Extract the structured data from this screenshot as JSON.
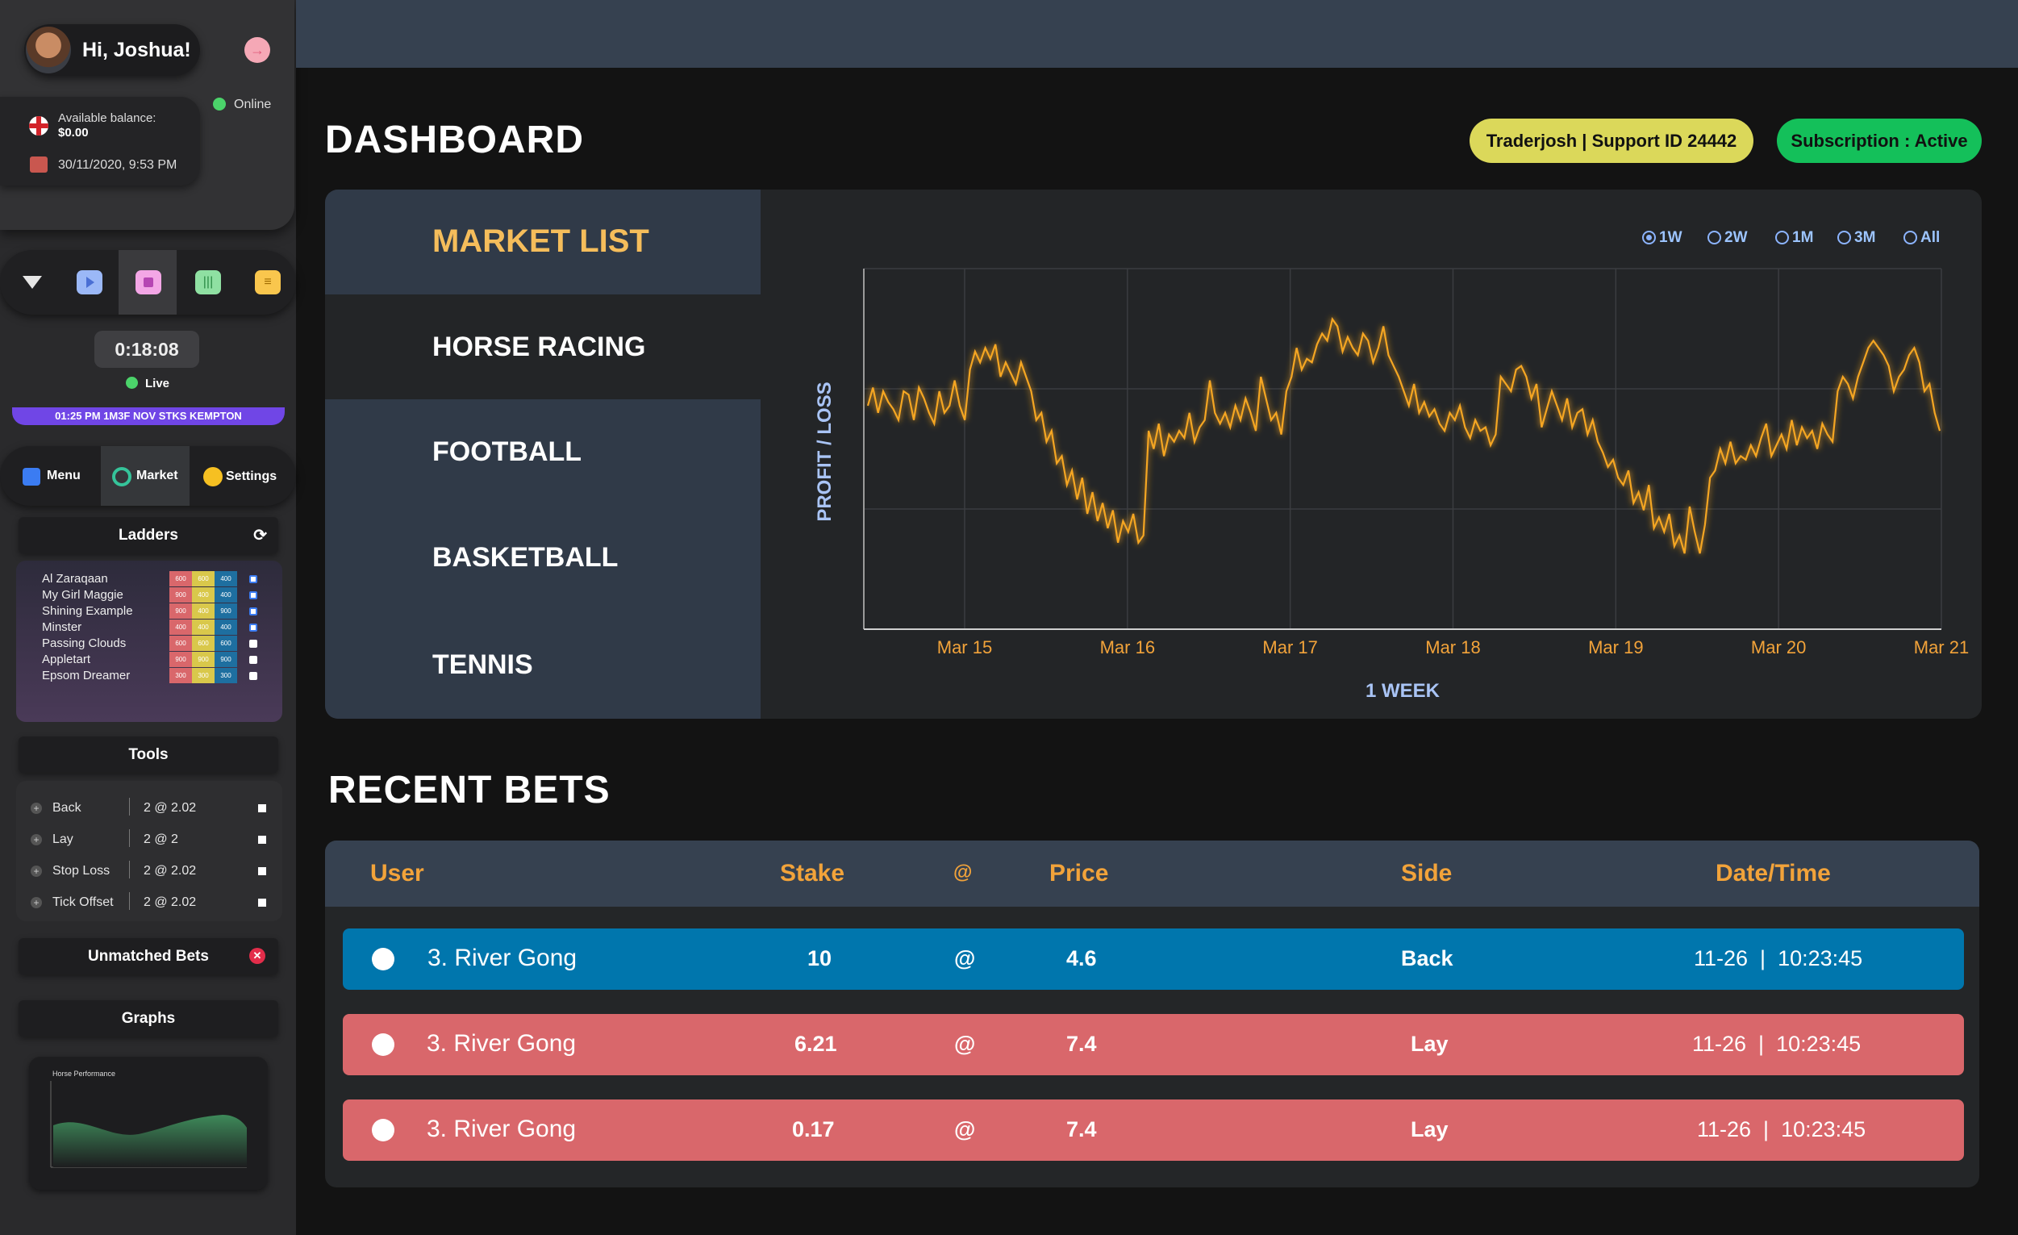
{
  "sidebar": {
    "greeting": "Hi, Joshua!",
    "status": "Online",
    "balance_label": "Available balance:",
    "balance_value": "$0.00",
    "datetime": "30/11/2020, 9:53 PM",
    "timer": "0:18:08",
    "live_label": "Live",
    "race_banner": "01:25 PM 1M3F NOV STKS KEMPTON",
    "tabs": [
      {
        "label": "Menu",
        "icon": "grid-icon"
      },
      {
        "label": "Market",
        "icon": "market-icon"
      },
      {
        "label": "Settings",
        "icon": "gear-icon"
      }
    ],
    "ladders_title": "Ladders",
    "ladders": [
      {
        "name": "Al Zaraqaan",
        "v": [
          "600",
          "600",
          "400"
        ],
        "checked": true
      },
      {
        "name": "My Girl Maggie",
        "v": [
          "900",
          "400",
          "400"
        ],
        "checked": true
      },
      {
        "name": "Shining Example",
        "v": [
          "900",
          "400",
          "900"
        ],
        "checked": true
      },
      {
        "name": "Minster",
        "v": [
          "400",
          "400",
          "400"
        ],
        "checked": true
      },
      {
        "name": "Passing Clouds",
        "v": [
          "600",
          "600",
          "600"
        ],
        "checked": false
      },
      {
        "name": "Appletart",
        "v": [
          "900",
          "900",
          "900"
        ],
        "checked": false
      },
      {
        "name": "Epsom Dreamer",
        "v": [
          "300",
          "300",
          "300"
        ],
        "checked": false
      }
    ],
    "tools_title": "Tools",
    "tools": [
      {
        "name": "Back",
        "value": "2 @ 2.02"
      },
      {
        "name": "Lay",
        "value": "2 @ 2"
      },
      {
        "name": "Stop Loss",
        "value": "2 @ 2.02"
      },
      {
        "name": "Tick Offset",
        "value": "2 @ 2.02"
      }
    ],
    "unmatched_title": "Unmatched Bets",
    "graphs_title": "Graphs",
    "mini_graph_title": "Horse Performance"
  },
  "header": {
    "title": "DASHBOARD",
    "support_badge": "Traderjosh | Support ID 24442",
    "subscription_badge": "Subscription : Active"
  },
  "market_list": {
    "title": "MARKET LIST",
    "items": [
      "HORSE RACING",
      "FOOTBALL",
      "BASKETBALL",
      "TENNIS"
    ]
  },
  "chart_data": {
    "type": "line",
    "ylabel": "PROFIT / LOSS",
    "xlabel": "1 WEEK",
    "x_ticks": [
      "Mar 15",
      "Mar 16",
      "Mar 17",
      "Mar 18",
      "Mar 19",
      "Mar 20",
      "Mar 21"
    ],
    "range_options": [
      "1W",
      "2W",
      "1M",
      "3M",
      "All"
    ],
    "range_selected": "1W",
    "series": [
      {
        "color": "#f5a623",
        "values": [
          0.62,
          0.67,
          0.6,
          0.66,
          0.63,
          0.61,
          0.58,
          0.66,
          0.65,
          0.58,
          0.67,
          0.64,
          0.6,
          0.57,
          0.66,
          0.6,
          0.62,
          0.69,
          0.62,
          0.58,
          0.72,
          0.77,
          0.74,
          0.78,
          0.75,
          0.79,
          0.7,
          0.74,
          0.71,
          0.68,
          0.74,
          0.7,
          0.66,
          0.58,
          0.6,
          0.52,
          0.55,
          0.46,
          0.48,
          0.4,
          0.44,
          0.36,
          0.42,
          0.32,
          0.38,
          0.3,
          0.35,
          0.28,
          0.33,
          0.24,
          0.3,
          0.27,
          0.32,
          0.24,
          0.26,
          0.55,
          0.5,
          0.57,
          0.48,
          0.54,
          0.52,
          0.55,
          0.53,
          0.6,
          0.52,
          0.56,
          0.58,
          0.69,
          0.6,
          0.57,
          0.6,
          0.56,
          0.62,
          0.58,
          0.64,
          0.6,
          0.55,
          0.7,
          0.64,
          0.58,
          0.6,
          0.54,
          0.66,
          0.7,
          0.78,
          0.72,
          0.75,
          0.74,
          0.79,
          0.82,
          0.8,
          0.86,
          0.84,
          0.77,
          0.81,
          0.78,
          0.76,
          0.82,
          0.8,
          0.74,
          0.78,
          0.84,
          0.76,
          0.73,
          0.7,
          0.66,
          0.62,
          0.68,
          0.6,
          0.63,
          0.59,
          0.61,
          0.57,
          0.55,
          0.6,
          0.58,
          0.62,
          0.56,
          0.53,
          0.58,
          0.55,
          0.56,
          0.51,
          0.54,
          0.7,
          0.68,
          0.66,
          0.72,
          0.73,
          0.7,
          0.64,
          0.68,
          0.56,
          0.61,
          0.66,
          0.62,
          0.58,
          0.64,
          0.56,
          0.6,
          0.61,
          0.54,
          0.58,
          0.52,
          0.49,
          0.45,
          0.47,
          0.42,
          0.4,
          0.44,
          0.35,
          0.38,
          0.33,
          0.4,
          0.28,
          0.31,
          0.27,
          0.32,
          0.23,
          0.26,
          0.21,
          0.34,
          0.27,
          0.21,
          0.29,
          0.42,
          0.44,
          0.5,
          0.46,
          0.52,
          0.46,
          0.48,
          0.47,
          0.51,
          0.48,
          0.53,
          0.57,
          0.48,
          0.51,
          0.54,
          0.5,
          0.58,
          0.51,
          0.56,
          0.53,
          0.55,
          0.5,
          0.57,
          0.54,
          0.52,
          0.66,
          0.7,
          0.68,
          0.64,
          0.7,
          0.74,
          0.78,
          0.8,
          0.78,
          0.76,
          0.73,
          0.66,
          0.7,
          0.72,
          0.76,
          0.78,
          0.74,
          0.66,
          0.68,
          0.6,
          0.55
        ]
      }
    ]
  },
  "recent_bets": {
    "title": "RECENT BETS",
    "columns": [
      "User",
      "Stake",
      "@",
      "Price",
      "Side",
      "Date/Time"
    ],
    "rows": [
      {
        "user": "3. River Gong",
        "stake": "10",
        "at": "@",
        "price": "4.6",
        "side": "Back",
        "datetime": "11-26  |  10:23:45",
        "color": "#0076ad"
      },
      {
        "user": "3. River Gong",
        "stake": "6.21",
        "at": "@",
        "price": "7.4",
        "side": "Lay",
        "datetime": "11-26  |  10:23:45",
        "color": "#d9676b"
      },
      {
        "user": "3. River Gong",
        "stake": "0.17",
        "at": "@",
        "price": "7.4",
        "side": "Lay",
        "datetime": "11-26  |  10:23:45",
        "color": "#d9676b"
      }
    ]
  }
}
